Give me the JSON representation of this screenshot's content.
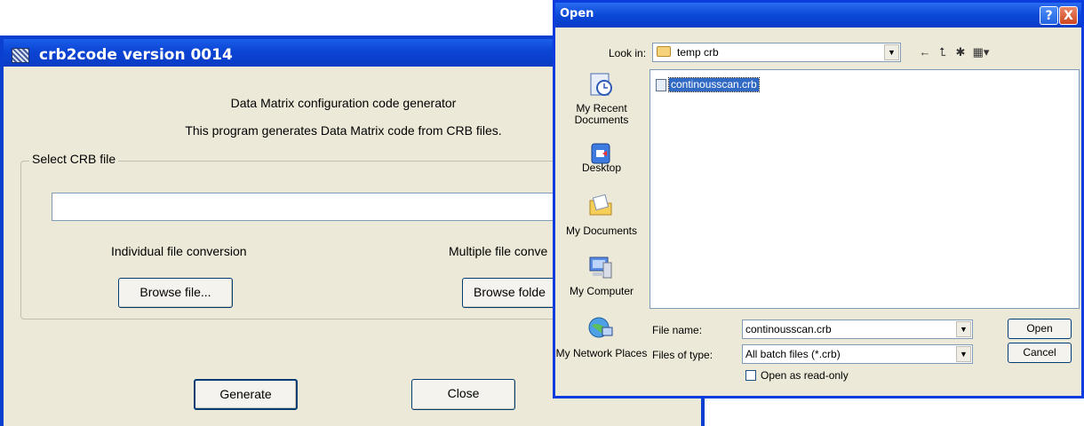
{
  "main_window": {
    "title": "crb2code version 0014",
    "heading": "Data Matrix configuration code generator",
    "description": "This program generates Data Matrix code from CRB files.",
    "group_label": "Select CRB file",
    "crb_path": "",
    "individual_label": "Individual file conversion",
    "multiple_label": "Multiple file conve",
    "browse_file_label": "Browse file...",
    "browse_folder_label": "Browse folde",
    "generate_label": "Generate",
    "close_label": "Close"
  },
  "open_dialog": {
    "title": "Open",
    "help_glyph": "?",
    "close_glyph": "X",
    "look_in_label": "Look in:",
    "look_in_value": "temp crb",
    "places": [
      {
        "label": "My Recent Documents",
        "icon": "recent-documents-icon"
      },
      {
        "label": "Desktop",
        "icon": "desktop-icon"
      },
      {
        "label": "My Documents",
        "icon": "my-documents-icon"
      },
      {
        "label": "My Computer",
        "icon": "my-computer-icon"
      },
      {
        "label": "My Network Places",
        "icon": "network-places-icon"
      }
    ],
    "files": [
      {
        "name": "continousscan.crb",
        "selected": true
      }
    ],
    "file_name_label": "File name:",
    "file_name_value": "continousscan.crb",
    "files_of_type_label": "Files of type:",
    "files_of_type_value": "All batch files (*.crb)",
    "read_only_label": "Open as read-only",
    "open_button": "Open",
    "cancel_button": "Cancel"
  },
  "colors": {
    "title_bar": "#0b44d4",
    "dialog_face": "#ece9d8",
    "selection": "#316ac5"
  }
}
